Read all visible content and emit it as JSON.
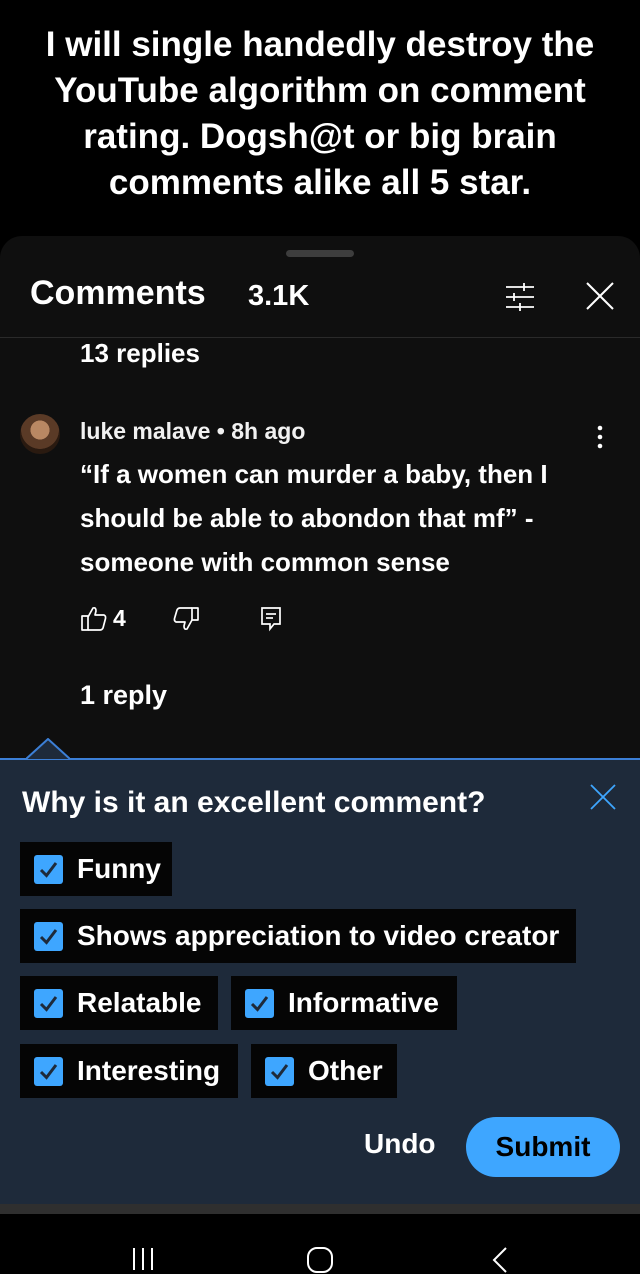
{
  "caption": "I will single handedly destroy the YouTube algorithm on comment rating. Dogsh@t or big brain comments alike all 5 star.",
  "comments_header": {
    "title": "Comments",
    "count": "3.1K",
    "filter_icon": "filter-icon",
    "close_icon": "close-icon"
  },
  "previous_thread": {
    "replies_label": "13 replies"
  },
  "comment": {
    "author": "luke malave",
    "separator": " • ",
    "time": "8h ago",
    "text": "“If a women can murder a baby, then I should be able to abondon that mf” - someone with common sense",
    "likes": "4",
    "replies_label": "1 reply"
  },
  "feedback_panel": {
    "question": "Why is it an excellent comment?",
    "options": [
      {
        "label": "Funny",
        "checked": true
      },
      {
        "label": "Shows appreciation to video creator",
        "checked": true
      },
      {
        "label": "Relatable",
        "checked": true
      },
      {
        "label": "Informative",
        "checked": true
      },
      {
        "label": "Interesting",
        "checked": true
      },
      {
        "label": "Other",
        "checked": true
      }
    ],
    "undo_label": "Undo",
    "submit_label": "Submit"
  },
  "colors": {
    "accent": "#3ea6ff",
    "panel": "#1e2a3a",
    "sheet": "#0f0f0f"
  },
  "nav_icons": [
    "recent-apps-icon",
    "home-icon",
    "back-icon"
  ]
}
